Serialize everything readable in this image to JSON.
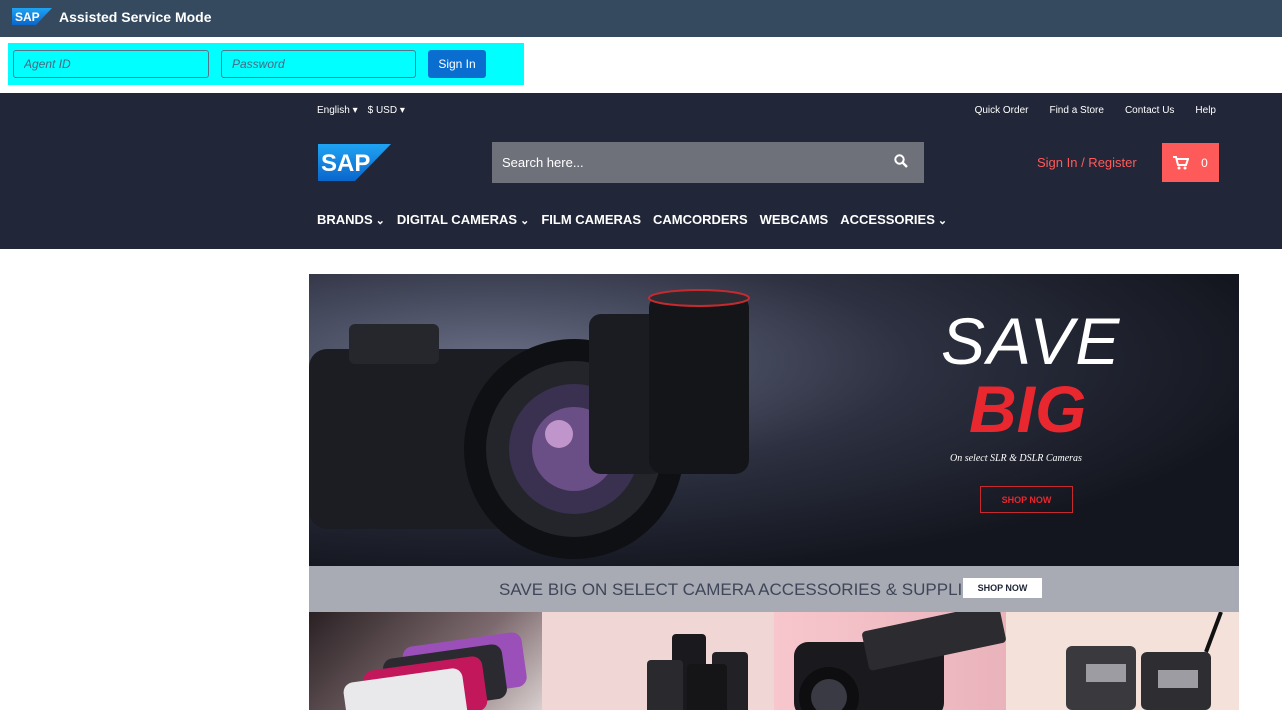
{
  "asm": {
    "title": "Assisted Service Mode",
    "logo_text": "SAP",
    "agent_placeholder": "Agent ID",
    "password_placeholder": "Password",
    "signin_label": "Sign In"
  },
  "header": {
    "language": "English",
    "currency": "$ USD",
    "utility_links": [
      "Quick Order",
      "Find a Store",
      "Contact Us",
      "Help"
    ],
    "logo_text": "SAP",
    "search_placeholder": "Search here...",
    "signin_register": "Sign In / Register",
    "cart_count": "0",
    "nav": [
      {
        "label": "BRANDS",
        "dropdown": true
      },
      {
        "label": "DIGITAL CAMERAS",
        "dropdown": true
      },
      {
        "label": "FILM CAMERAS",
        "dropdown": false
      },
      {
        "label": "CAMCORDERS",
        "dropdown": false
      },
      {
        "label": "WEBCAMS",
        "dropdown": false
      },
      {
        "label": "ACCESSORIES",
        "dropdown": true
      }
    ]
  },
  "hero": {
    "headline_1": "SAVE",
    "headline_2": "BIG",
    "subtitle": "On select SLR & DSLR Cameras",
    "button": "SHOP NOW"
  },
  "promo_strip": {
    "text": "SAVE BIG ON SELECT CAMERA ACCESSORIES & SUPPLIES",
    "button": "SHOP NOW"
  },
  "colors": {
    "asm_bar": "#354a5f",
    "asm_highlight": "#00ffff",
    "header_bg": "#212738",
    "accent_red": "#ff5a5a",
    "sap_blue": "#0a6ed1"
  }
}
